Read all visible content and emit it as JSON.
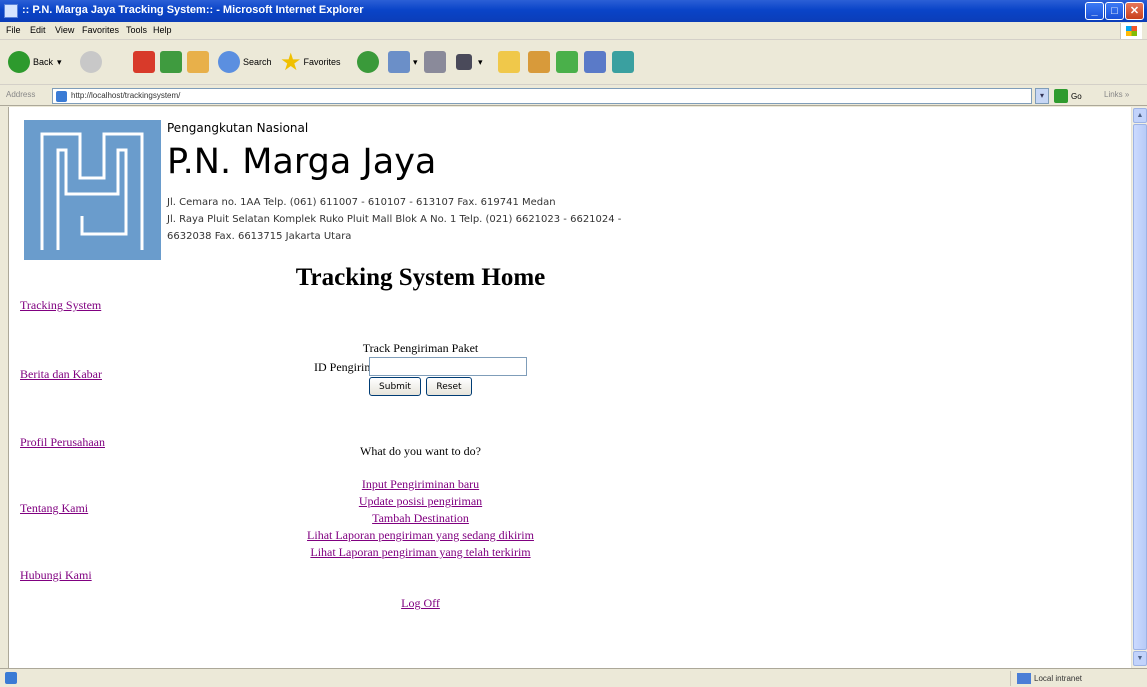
{
  "window": {
    "title": ":: P.N. Marga Jaya Tracking System:: - Microsoft Internet Explorer",
    "min": "_",
    "max": "□",
    "close": "✕"
  },
  "menu": [
    "File",
    "Edit",
    "View",
    "Favorites",
    "Tools",
    "Help"
  ],
  "toolbar": {
    "back": "Back",
    "search": "Search",
    "favorites": "Favorites"
  },
  "address": {
    "label": "Address",
    "value": "http://localhost/trackingsystem/",
    "go": "Go",
    "links": "Links »"
  },
  "header": {
    "kicker": "Pengangkutan Nasional",
    "company": "P.N. Marga Jaya",
    "address_line1": "Jl. Cemara no. 1AA Telp. (061) 611007 - 610107 - 613107 Fax. 619741 Medan",
    "address_line2": "Jl. Raya Pluit Selatan Komplek Ruko Pluit Mall Blok A No. 1 Telp. (021) 6621023 - 6621024 -",
    "address_line3": "6632038 Fax. 6613715 Jakarta Utara"
  },
  "page_title": "Tracking System Home",
  "nav": [
    {
      "label": "Tracking System"
    },
    {
      "label": "Berita dan Kabar"
    },
    {
      "label": "Profil Perusahaan"
    },
    {
      "label": "Tentang Kami"
    },
    {
      "label": "Hubungi Kami"
    }
  ],
  "track_form": {
    "title": "Track Pengiriman Paket",
    "id_label": "ID Pengiriman:",
    "id_value": "",
    "submit": "Submit",
    "reset": "Reset"
  },
  "actions": {
    "question": "What do you want to do?",
    "links": [
      "Input Pengiriminan baru",
      "Update posisi pengiriman",
      "Tambah Destination",
      "Lihat Laporan pengiriman yang sedang dikirim",
      "Lihat Laporan pengiriman yang telah terkirim"
    ],
    "logoff": "Log Off"
  },
  "status": {
    "zone": "Local intranet"
  },
  "colors": {
    "logo": "#6a9ccc",
    "link_visited": "#800080",
    "titlebar": "#0a44c8"
  }
}
